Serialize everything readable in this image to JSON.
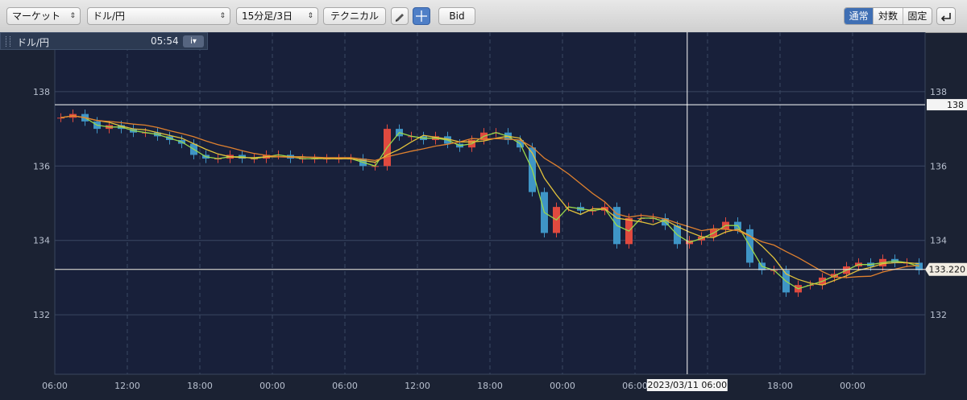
{
  "toolbar": {
    "market_select": "マーケット",
    "pair_select": "ドル/円",
    "timeframe_select": "15分足/3日",
    "technical_button": "テクニカル",
    "bid_button": "Bid",
    "scale_modes": [
      "通常",
      "対数",
      "固定"
    ],
    "scale_active": "通常"
  },
  "info_box": {
    "symbol": "ドル/円",
    "time": "05:54",
    "info_button": "i▾"
  },
  "crosshair": {
    "date_label": "2023/03/11 06:00",
    "price_label": "138"
  },
  "current_price_label": "133.220",
  "colors": {
    "background": "#1b2233",
    "up_candle": "#e04a3f",
    "down_candle": "#3f95c6",
    "ma_short": "#9ad84b",
    "ma_mid": "#e3c33b",
    "ma_long": "#e0812e",
    "crosshair": "#ffffff"
  },
  "chart_data": {
    "type": "line",
    "xlabel": "",
    "ylabel": "",
    "x_tick_labels": [
      "06:00",
      "12:00",
      "18:00",
      "00:00",
      "06:00",
      "12:00",
      "18:00",
      "00:00",
      "06:00",
      "12:00",
      "18:00",
      "00:00"
    ],
    "y_tick_labels": [
      "132",
      "134",
      "136",
      "138"
    ],
    "ylim": [
      130.4,
      139.6
    ],
    "grid": true,
    "series": [
      {
        "values": [
          137.3,
          137.4,
          137.2,
          137.0,
          137.1,
          137.0,
          136.9,
          136.9,
          136.8,
          136.7,
          136.6,
          136.3,
          136.2,
          136.2,
          136.3,
          136.2,
          136.2,
          136.3,
          136.3,
          136.2,
          136.2,
          136.2,
          136.2,
          136.2,
          136.2,
          136.0,
          136.0,
          137.0,
          136.8,
          136.8,
          136.7,
          136.8,
          136.6,
          136.5,
          136.7,
          136.9,
          136.9,
          136.7,
          136.5,
          135.3,
          134.2,
          134.9,
          134.9,
          134.8,
          134.8,
          134.9,
          133.9,
          134.6,
          134.6,
          134.6,
          134.4,
          133.9,
          134.0,
          134.1,
          134.3,
          134.5,
          134.3,
          133.4,
          133.2,
          133.2,
          132.6,
          132.8,
          132.8,
          133.0,
          133.1,
          133.3,
          133.4,
          133.3,
          133.5,
          133.4,
          133.4,
          133.2
        ]
      }
    ]
  }
}
